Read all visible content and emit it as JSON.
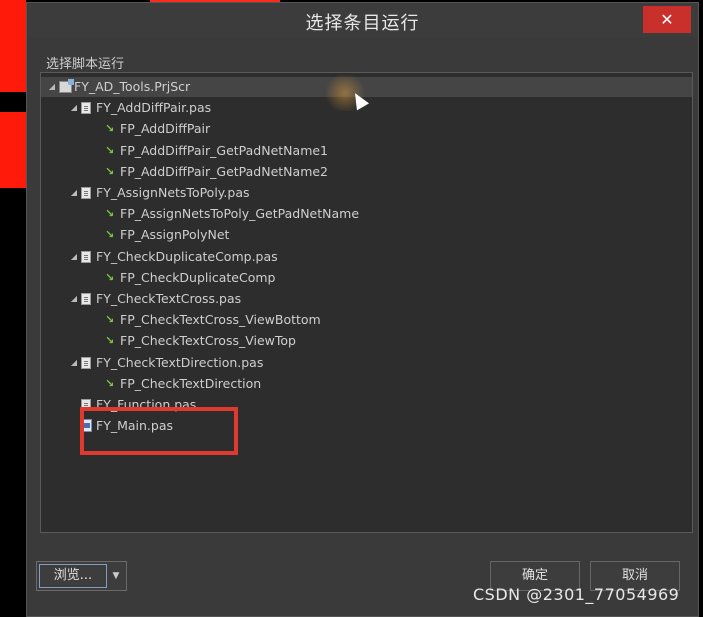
{
  "dialog": {
    "title": "选择条目运行",
    "close_icon": "close-icon",
    "group_label": "选择脚本运行"
  },
  "tree": [
    {
      "label": "FY_AD_Tools.PrjScr",
      "type": "project",
      "level": 0,
      "expanded": true,
      "selected": true
    },
    {
      "label": "FY_AddDiffPair.pas",
      "type": "file",
      "level": 1,
      "expanded": true
    },
    {
      "label": "FP_AddDiffPair",
      "type": "function",
      "level": 2
    },
    {
      "label": "FP_AddDiffPair_GetPadNetName1",
      "type": "function",
      "level": 2
    },
    {
      "label": "FP_AddDiffPair_GetPadNetName2",
      "type": "function",
      "level": 2
    },
    {
      "label": "FY_AssignNetsToPoly.pas",
      "type": "file",
      "level": 1,
      "expanded": true
    },
    {
      "label": "FP_AssignNetsToPoly_GetPadNetName",
      "type": "function",
      "level": 2
    },
    {
      "label": "FP_AssignPolyNet",
      "type": "function",
      "level": 2
    },
    {
      "label": "FY_CheckDuplicateComp.pas",
      "type": "file",
      "level": 1,
      "expanded": true
    },
    {
      "label": "FP_CheckDuplicateComp",
      "type": "function",
      "level": 2
    },
    {
      "label": "FY_CheckTextCross.pas",
      "type": "file",
      "level": 1,
      "expanded": true
    },
    {
      "label": "FP_CheckTextCross_ViewBottom",
      "type": "function",
      "level": 2
    },
    {
      "label": "FP_CheckTextCross_ViewTop",
      "type": "function",
      "level": 2
    },
    {
      "label": "FY_CheckTextDirection.pas",
      "type": "file",
      "level": 1,
      "expanded": true
    },
    {
      "label": "FP_CheckTextDirection",
      "type": "function",
      "level": 2
    },
    {
      "label": "FY_Function.pas",
      "type": "file",
      "level": 1,
      "expanded": false
    },
    {
      "label": "FY_Main.pas",
      "type": "main",
      "level": 1,
      "expanded": false
    }
  ],
  "buttons": {
    "browse_label": "浏览...",
    "browse_dropdown_icon": "chevron-down-icon",
    "ok_label": "确定",
    "cancel_label": "取消"
  },
  "watermark": "CSDN @2301_77054969",
  "colors": {
    "highlight_box": "#e03a30",
    "close_button": "#c9302c",
    "background": "#3a3a3a"
  }
}
